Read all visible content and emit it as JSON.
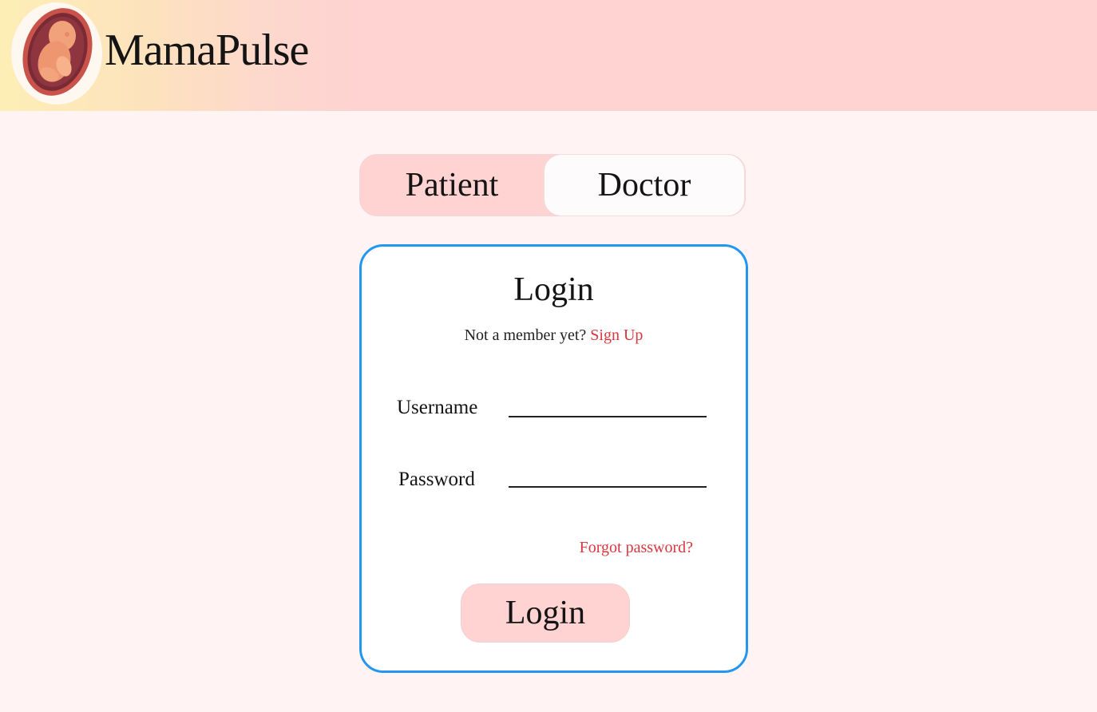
{
  "header": {
    "brand": "MamaPulse",
    "logo_icon": "fetus-in-womb-icon"
  },
  "role_toggle": {
    "patient_label": "Patient",
    "doctor_label": "Doctor",
    "selected": "Patient"
  },
  "login_card": {
    "title": "Login",
    "member_prompt": "Not a member yet?",
    "signup_link": "Sign Up",
    "username_label": "Username",
    "username_value": "",
    "password_label": "Password",
    "password_value": "",
    "forgot_link": "Forgot password?",
    "submit_label": "Login"
  },
  "colors": {
    "accent_pink": "#fed3d2",
    "link_red": "#d9363e",
    "card_border_blue": "#2196f3",
    "page_background": "#fff4f3"
  }
}
